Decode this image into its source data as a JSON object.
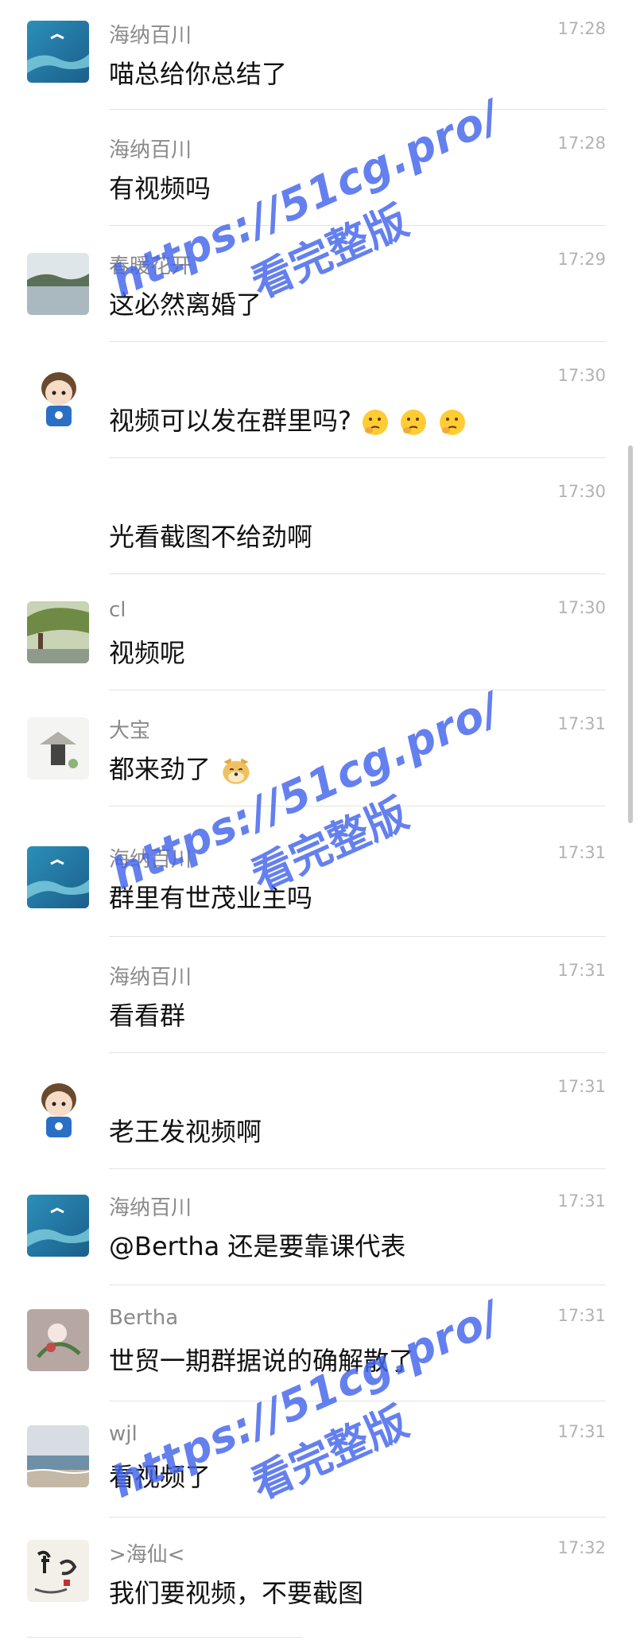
{
  "messages": [
    {
      "name": "海纳百川",
      "time": "17:28",
      "text": "喵总给你总结了",
      "avatar": "ocean-avatar"
    },
    {
      "name": "海纳百川",
      "time": "17:28",
      "text": "有视频吗",
      "avatar": "none"
    },
    {
      "name": "春暖花开",
      "time": "17:29",
      "text": "这必然离婚了",
      "avatar": "lake-avatar"
    },
    {
      "name": "",
      "time": "17:30",
      "text": "视频可以发在群里吗?",
      "avatar": "cartoon-boy-avatar"
    },
    {
      "name": "",
      "time": "17:30",
      "text": "光看截图不给劲啊",
      "avatar": "none"
    },
    {
      "name": "cl",
      "time": "17:30",
      "text": "视频呢",
      "avatar": "garden-avatar"
    },
    {
      "name": "大宝",
      "time": "17:31",
      "text": "都来劲了",
      "avatar": "hat-sketch-avatar"
    },
    {
      "name": "海纳百川",
      "time": "17:31",
      "text": "群里有世茂业主吗",
      "avatar": "ocean-avatar"
    },
    {
      "name": "海纳百川",
      "time": "17:31",
      "text": "看看群",
      "avatar": "none"
    },
    {
      "name": "",
      "time": "17:31",
      "text": "老王发视频啊",
      "avatar": "cartoon-boy-avatar"
    },
    {
      "name": "海纳百川",
      "time": "17:31",
      "text": "@Bertha 还是要靠课代表",
      "avatar": "ocean-avatar"
    },
    {
      "name": "Bertha",
      "time": "17:31",
      "text": "世贸一期群据说的确解散了",
      "avatar": "flower-avatar"
    },
    {
      "name": "wjl",
      "time": "17:31",
      "text": "看视频了",
      "avatar": "sea-avatar"
    },
    {
      "name": ">海仙<",
      "time": "17:32",
      "text": "我们要视频，不要截图",
      "avatar": "calligraphy-avatar"
    }
  ],
  "emojis": {
    "thinking": "thinking-face-icon",
    "doge": "doge-icon"
  },
  "watermark": {
    "line1": "https://51cg.pro/",
    "line2": "看完整版"
  },
  "colors": {
    "watermark": "#4264eb",
    "name": "#8a8a8a",
    "time": "#b2b2b2",
    "text": "#111111"
  }
}
